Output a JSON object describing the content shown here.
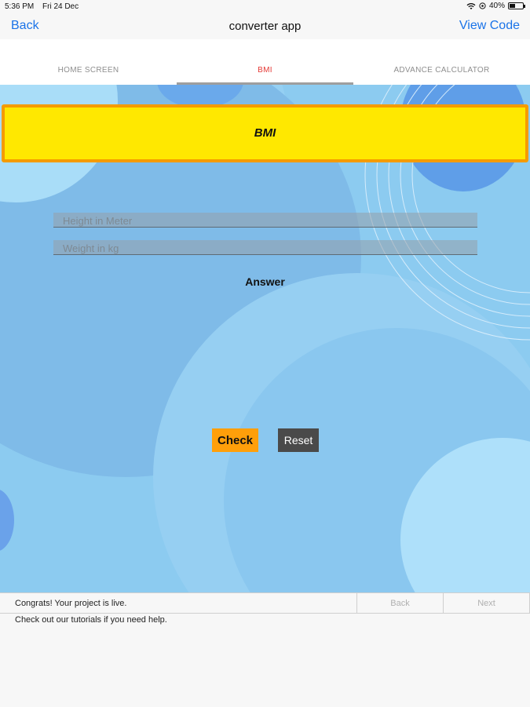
{
  "status": {
    "time": "5:36 PM",
    "date": "Fri 24 Dec",
    "battery": "40%"
  },
  "nav": {
    "back": "Back",
    "title": "converter app",
    "view_code": "View Code"
  },
  "tabs": [
    {
      "label": "HOME SCREEN",
      "active": false
    },
    {
      "label": "BMI",
      "active": true
    },
    {
      "label": "ADVANCE CALCULATOR",
      "active": false
    }
  ],
  "bmi": {
    "title": "BMI",
    "height_placeholder": "Height in Meter",
    "weight_placeholder": "Weight in kg",
    "answer": "Answer",
    "check": "Check",
    "reset": "Reset"
  },
  "footer": {
    "message": "Congrats! Your project is live.",
    "back": "Back",
    "next": "Next",
    "help": "Check out our tutorials if you need help."
  },
  "colors": {
    "accent": "#1a73e8",
    "banner": "#ffe800",
    "banner_border": "#f59b00",
    "check": "#ff9f0a",
    "reset": "#4a4a4a",
    "active_tab": "#e53935"
  }
}
